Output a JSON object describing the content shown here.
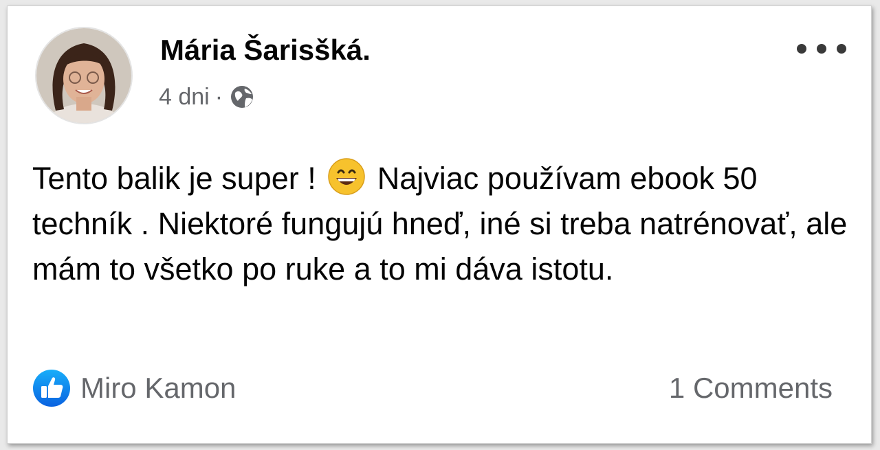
{
  "post": {
    "author": "Mária Šarisšká.",
    "time": "4 dni",
    "separator": "·",
    "privacy_icon": "globe-icon",
    "more_icon": "more-dots-icon",
    "text_part1": "Tento balik je super !",
    "emoji": "grinning-face-icon",
    "text_part2": "Najviac používam ebook 50 techník . Niektoré fungujú hneď, iné si treba natrénovať, ale mám to všetko po ruke a to mi dáva istotu."
  },
  "footer": {
    "like_icon": "thumbs-up-icon",
    "liked_by": "Miro Kamon",
    "comments": "1 Comments"
  },
  "colors": {
    "text": "#050505",
    "secondary_text": "#65676b",
    "like_blue": "#1877f2",
    "emoji_yellow": "#f7c22d"
  }
}
